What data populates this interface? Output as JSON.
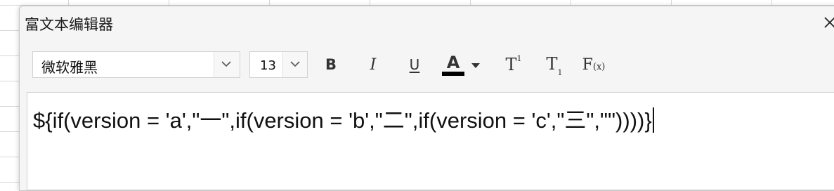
{
  "dialog": {
    "title": "富文本编辑器",
    "close_icon": "close-x-icon"
  },
  "toolbar": {
    "font_family": "微软雅黑",
    "font_size": "13",
    "bold_label": "B",
    "italic_label": "I",
    "underline_label": "U",
    "font_color_label": "A",
    "font_color": "#000000",
    "superscript_label": "T",
    "superscript_mark": "1",
    "subscript_label": "T",
    "subscript_mark": "1",
    "formula_label": "F",
    "formula_mark": "(x)",
    "icons": [
      "chevron-down-icon",
      "bold-icon",
      "italic-icon",
      "underline-icon",
      "font-color-icon",
      "superscript-icon",
      "subscript-icon",
      "formula-icon"
    ]
  },
  "editor": {
    "content": "${if(version = 'a',\"一\",if(version = 'b',\"二\",if(version = 'c',\"三\",\"\"))))}"
  }
}
